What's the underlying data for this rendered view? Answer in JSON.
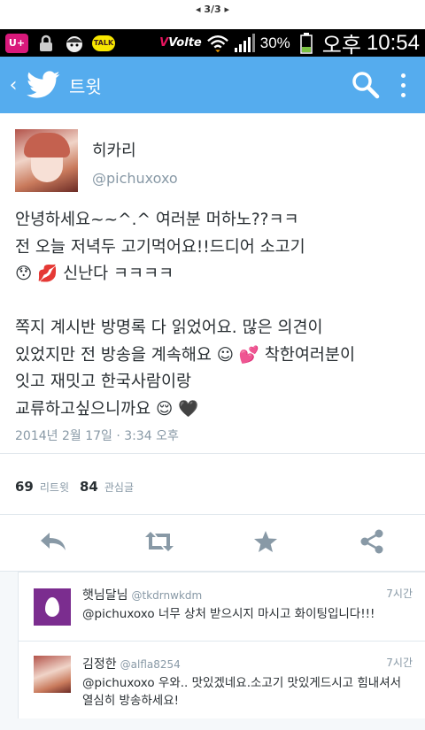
{
  "page_indicator": "◂ 3/3 ▸",
  "status_bar": {
    "carrier_icon": "lg-uplus-icon",
    "volte": "Volte",
    "battery": "30%",
    "ampm": "오후",
    "time": "10:54"
  },
  "app_bar": {
    "title": "트윗",
    "brand_color": "#55acee"
  },
  "tweet": {
    "author_name": "히카리",
    "author_handle": "@pichuxoxo",
    "text": "안녕하세요~~^.^ 여러분 머하노??ㅋㅋ\n전 오늘 저녁두 고기먹어요!!드디어 소고기\n😯 💋 신난다 ㅋㅋㅋㅋ\n\n쪽지 계시반 방명록 다 읽었어요. 많은 의견이\n있었지만 전 방송을 계속해요 ☺ 💕 착한여러분이\n잇고 재밋고 한국사람이랑\n교류하고싶으니까요 😌 🖤",
    "timestamp": "2014년 2월 17일 · 3:34 오후",
    "retweets": "69",
    "retweets_label": "리트윗",
    "favorites": "84",
    "favorites_label": "관심글"
  },
  "replies": [
    {
      "name": "햇님달님",
      "handle": "@tkdrnwkdm",
      "time": "7시간",
      "text": "@pichuxoxo 너무 상처 받으시지 마시고 화이팅입니다!!!"
    },
    {
      "name": "김정한",
      "handle": "@alfla8254",
      "time": "7시간",
      "text": "@pichuxoxo 우와.. 맛있겠네요.소고기 맛있게드시고 힘내셔서 열심히 방송하세요!"
    }
  ]
}
